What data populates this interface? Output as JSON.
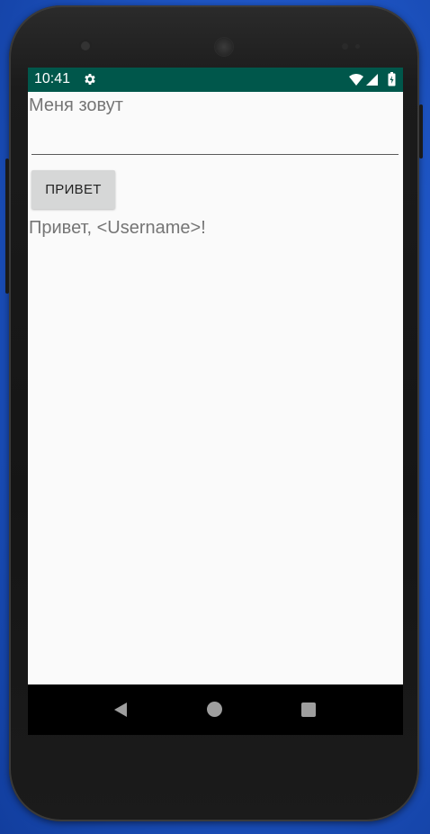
{
  "status_bar": {
    "time": "10:41",
    "icons": [
      "gear-icon",
      "wifi-icon",
      "signal-icon",
      "battery-icon"
    ],
    "color": "#00574b"
  },
  "form": {
    "name_label": "Меня зовут",
    "name_input_value": "",
    "button_label": "ПРИВЕТ",
    "greeting_text": "Привет, <Username>!"
  },
  "nav_bar": {
    "icons": [
      "back-icon",
      "home-icon",
      "recents-icon"
    ]
  }
}
